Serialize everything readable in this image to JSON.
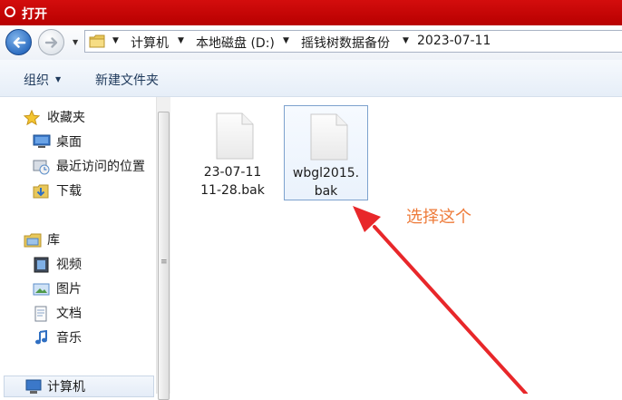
{
  "window": {
    "title": "打开"
  },
  "address": {
    "crumbs": [
      "计算机",
      "本地磁盘 (D:)",
      "摇钱树数据备份",
      "2023-07-11"
    ]
  },
  "toolbar": {
    "organize": "组织",
    "new_folder": "新建文件夹"
  },
  "nav": {
    "favorites": {
      "label": "收藏夹",
      "items": [
        "桌面",
        "最近访问的位置",
        "下载"
      ]
    },
    "libraries": {
      "label": "库",
      "items": [
        "视频",
        "图片",
        "文档",
        "音乐"
      ]
    },
    "computer": {
      "label": "计算机"
    }
  },
  "files": [
    {
      "line1": "23-07-11",
      "line2": "11-28.bak"
    },
    {
      "line1": "wbgl2015.",
      "line2": "bak",
      "selected": true
    }
  ],
  "annotation": {
    "text": "选择这个",
    "color": "#ee7b3a"
  },
  "colors": {
    "title_bar": "#c30606",
    "arrow": "#e8272a",
    "accent": "#2f6fc2"
  }
}
